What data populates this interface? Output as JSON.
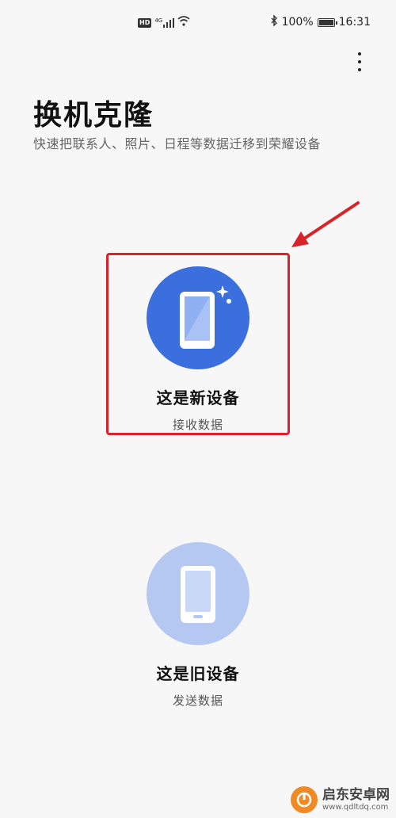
{
  "status_bar": {
    "hd_label": "HD",
    "signal_label": "4G",
    "battery_text": "100%",
    "time": "16:31"
  },
  "header": {
    "title": "换机克隆",
    "subtitle": "快速把联系人、照片、日程等数据迁移到荣耀设备"
  },
  "options": {
    "new_device": {
      "title": "这是新设备",
      "subtitle": "接收数据",
      "circle_color": "#3a6fdd"
    },
    "old_device": {
      "title": "这是旧设备",
      "subtitle": "发送数据",
      "circle_color": "#b4c8f2"
    }
  },
  "annotation": {
    "highlight_color": "#d8232a"
  },
  "watermark": {
    "name": "启东安卓网",
    "url": "www.qdltdq.com"
  }
}
